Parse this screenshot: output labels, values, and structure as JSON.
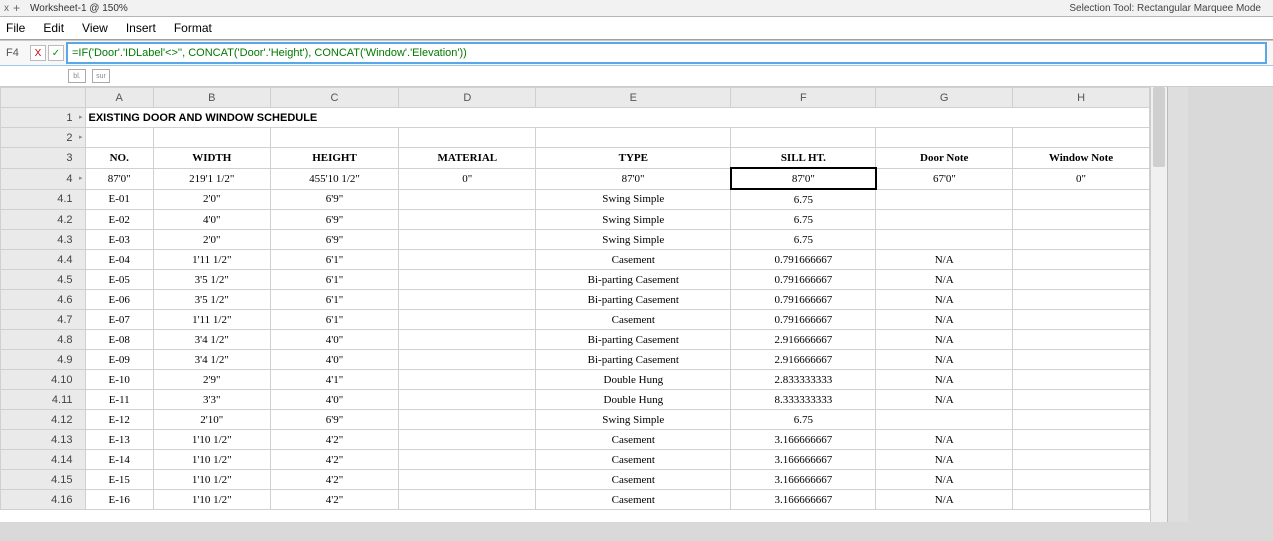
{
  "top": {
    "close": "x",
    "plus": "+",
    "tab_title": "Worksheet-1 @ 150%",
    "selection_info": "Selection Tool: Rectangular Marquee Mode"
  },
  "menu": {
    "file": "File",
    "edit": "Edit",
    "view": "View",
    "insert": "Insert",
    "format": "Format"
  },
  "fx": {
    "cell": "F4",
    "cancel": "X",
    "accept": "✓",
    "formula": "=IF('Door'.'IDLabel'<>'', CONCAT('Door'.'Height'), CONCAT('Window'.'Elevation'))"
  },
  "mini": {
    "a": "bl.",
    "b": "sur"
  },
  "columns": [
    "A",
    "B",
    "C",
    "D",
    "E",
    "F",
    "G",
    "H"
  ],
  "head": {
    "no": "NO.",
    "width": "WIDTH",
    "height": "HEIGHT",
    "material": "MATERIAL",
    "type": "TYPE",
    "sill": "SILL HT.",
    "door": "Door Note",
    "window": "Window Note"
  },
  "title_row": {
    "label": "1",
    "arrow": "▸",
    "text": "EXISTING DOOR AND WINDOW SCHEDULE"
  },
  "row2": {
    "label": "2",
    "arrow": "▸"
  },
  "row3": {
    "label": "3"
  },
  "sumrow": {
    "label": "4",
    "arrow": "▸",
    "pager": "+ -",
    "no": "87'0\"",
    "width": "219'1 1/2\"",
    "height": "455'10 1/2\"",
    "material": "0\"",
    "type": "87'0\"",
    "sill": "87'0\"",
    "door": "67'0\"",
    "window": "0\""
  },
  "rows": [
    {
      "label": "4.1",
      "no": "E-01",
      "width": "2'0\"",
      "height": "6'9\"",
      "material": "",
      "type": "Swing Simple",
      "sill": "6.75",
      "door": "",
      "window": ""
    },
    {
      "label": "4.2",
      "no": "E-02",
      "width": "4'0\"",
      "height": "6'9\"",
      "material": "",
      "type": "Swing Simple",
      "sill": "6.75",
      "door": "",
      "window": ""
    },
    {
      "label": "4.3",
      "no": "E-03",
      "width": "2'0\"",
      "height": "6'9\"",
      "material": "",
      "type": "Swing Simple",
      "sill": "6.75",
      "door": "",
      "window": ""
    },
    {
      "label": "4.4",
      "no": "E-04",
      "width": "1'11 1/2\"",
      "height": "6'1\"",
      "material": "",
      "type": "Casement",
      "sill": "0.791666667",
      "door": "N/A",
      "window": ""
    },
    {
      "label": "4.5",
      "no": "E-05",
      "width": "3'5 1/2\"",
      "height": "6'1\"",
      "material": "",
      "type": "Bi-parting Casement",
      "sill": "0.791666667",
      "door": "N/A",
      "window": ""
    },
    {
      "label": "4.6",
      "no": "E-06",
      "width": "3'5 1/2\"",
      "height": "6'1\"",
      "material": "",
      "type": "Bi-parting Casement",
      "sill": "0.791666667",
      "door": "N/A",
      "window": ""
    },
    {
      "label": "4.7",
      "no": "E-07",
      "width": "1'11 1/2\"",
      "height": "6'1\"",
      "material": "",
      "type": "Casement",
      "sill": "0.791666667",
      "door": "N/A",
      "window": ""
    },
    {
      "label": "4.8",
      "no": "E-08",
      "width": "3'4 1/2\"",
      "height": "4'0\"",
      "material": "",
      "type": "Bi-parting Casement",
      "sill": "2.916666667",
      "door": "N/A",
      "window": ""
    },
    {
      "label": "4.9",
      "no": "E-09",
      "width": "3'4 1/2\"",
      "height": "4'0\"",
      "material": "",
      "type": "Bi-parting Casement",
      "sill": "2.916666667",
      "door": "N/A",
      "window": ""
    },
    {
      "label": "4.10",
      "no": "E-10",
      "width": "2'9\"",
      "height": "4'1\"",
      "material": "",
      "type": "Double Hung",
      "sill": "2.833333333",
      "door": "N/A",
      "window": ""
    },
    {
      "label": "4.11",
      "no": "E-11",
      "width": "3'3\"",
      "height": "4'0\"",
      "material": "",
      "type": "Double Hung",
      "sill": "8.333333333",
      "door": "N/A",
      "window": ""
    },
    {
      "label": "4.12",
      "no": "E-12",
      "width": "2'10\"",
      "height": "6'9\"",
      "material": "",
      "type": "Swing Simple",
      "sill": "6.75",
      "door": "",
      "window": ""
    },
    {
      "label": "4.13",
      "no": "E-13",
      "width": "1'10 1/2\"",
      "height": "4'2\"",
      "material": "",
      "type": "Casement",
      "sill": "3.166666667",
      "door": "N/A",
      "window": ""
    },
    {
      "label": "4.14",
      "no": "E-14",
      "width": "1'10 1/2\"",
      "height": "4'2\"",
      "material": "",
      "type": "Casement",
      "sill": "3.166666667",
      "door": "N/A",
      "window": ""
    },
    {
      "label": "4.15",
      "no": "E-15",
      "width": "1'10 1/2\"",
      "height": "4'2\"",
      "material": "",
      "type": "Casement",
      "sill": "3.166666667",
      "door": "N/A",
      "window": ""
    },
    {
      "label": "4.16",
      "no": "E-16",
      "width": "1'10 1/2\"",
      "height": "4'2\"",
      "material": "",
      "type": "Casement",
      "sill": "3.166666667",
      "door": "N/A",
      "window": ""
    }
  ]
}
